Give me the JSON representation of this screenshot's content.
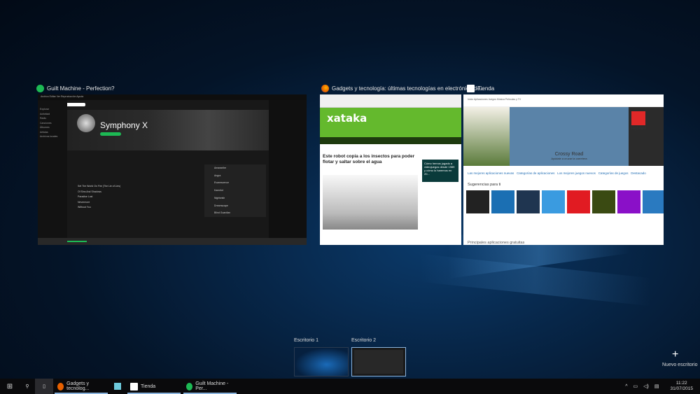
{
  "windows": [
    {
      "title": "Guilt Machine - Perfection?",
      "app": "spotify",
      "icon": "spotify-icon",
      "content": {
        "menu": "Archivo  Editar  Ver  Reproducción  Ayuda",
        "search": "Buscar",
        "artist": "Symphony X",
        "sidebar": [
          "Explorar",
          "Actividad",
          "Radio",
          "Canciones",
          "Álbumes",
          "Artistas",
          "Archivos locales"
        ],
        "tracks": [
          "Set The World On Fire (The Lie of Lies)",
          "Of Sins And Shadows",
          "Paradise Lost",
          "Nevermore",
          "Without You"
        ],
        "related": [
          "Amaranthe",
          "Angra",
          "Evanescence",
          "Kamelot",
          "Nightwish",
          "Dreamscape",
          "Blind Guardian"
        ]
      }
    },
    {
      "title": "Gadgets y tecnología: últimas tecnologías en electrónica de...",
      "app": "firefox",
      "icon": "firefox-icon",
      "content": {
        "logo": "xataka",
        "headline": "Este robot copia a los insectos para poder flotar y saltar sobre el agua",
        "ad": "Cómo hemos jugado a videojuegos desde 1989 y cómo lo haremos en 20..."
      }
    },
    {
      "title": "Tienda",
      "app": "store",
      "icon": "store-icon",
      "content": {
        "tabs": "Inicio   Aplicaciones   Juegos   Música   Películas y TV",
        "banner_title": "Crossy Road",
        "banner_sub": "Ayúdale a cruzar la carretera",
        "side_banner": "Flipboard",
        "links": [
          "Las mejores aplicaciones nuevas",
          "Categorías de aplicaciones",
          "Los mejores juegos nuevos",
          "Categorías de juegos",
          "Destacado"
        ],
        "section": "Sugerencias para ti",
        "section2": "Principales aplicaciones gratuitas"
      }
    }
  ],
  "desktops": [
    {
      "label": "Escritorio 1"
    },
    {
      "label": "Escritorio 2",
      "active": true
    }
  ],
  "new_desktop": "Nuevo escritorio",
  "taskbar": {
    "items": [
      {
        "label": "Gadgets y tecnolog...",
        "icon": "firefox-icon"
      },
      {
        "label": "",
        "icon": "slack-icon"
      },
      {
        "label": "Tienda",
        "icon": "store-icon"
      },
      {
        "label": "Guilt Machine - Per...",
        "icon": "spotify-icon"
      }
    ],
    "time": "11:22",
    "date": "31/07/2015"
  },
  "colors": {
    "spotify": "#1db954",
    "firefox": "#e66000",
    "xataka": "#64b92d",
    "accent": "#8ab4de"
  }
}
